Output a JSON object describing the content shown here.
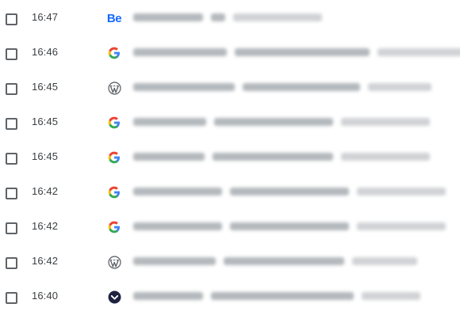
{
  "history": {
    "entries": [
      {
        "time": "16:47",
        "site_icon": "behance-icon"
      },
      {
        "time": "16:46",
        "site_icon": "google-icon"
      },
      {
        "time": "16:45",
        "site_icon": "wordpress-icon"
      },
      {
        "time": "16:45",
        "site_icon": "google-icon"
      },
      {
        "time": "16:45",
        "site_icon": "google-icon"
      },
      {
        "time": "16:42",
        "site_icon": "google-icon"
      },
      {
        "time": "16:42",
        "site_icon": "google-icon"
      },
      {
        "time": "16:42",
        "site_icon": "wordpress-icon"
      },
      {
        "time": "16:40",
        "site_icon": "pocket-style-icon"
      }
    ]
  },
  "colors": {
    "behance_blue": "#1769ff",
    "wordpress_gray": "#5f6368",
    "dark_circle": "#1f2340"
  }
}
